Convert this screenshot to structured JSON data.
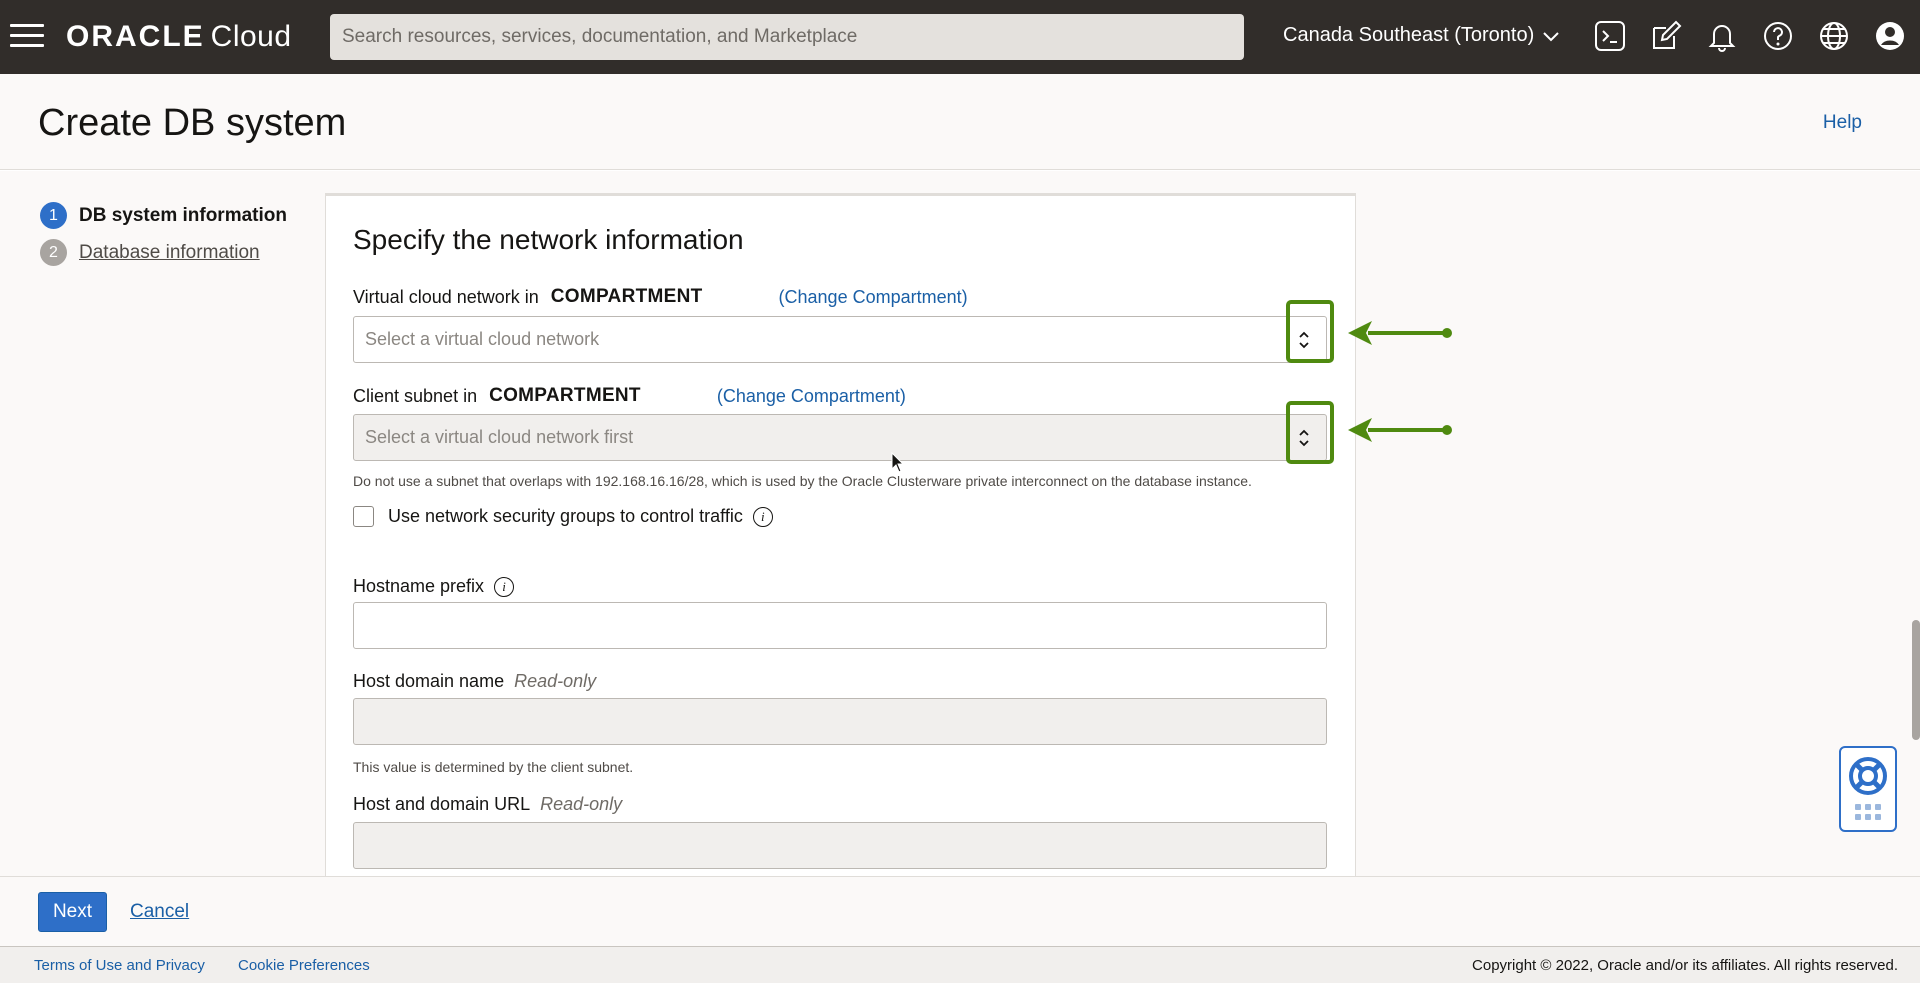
{
  "topbar": {
    "brand_main": "ORACLE",
    "brand_sub": "Cloud",
    "search_placeholder": "Search resources, services, documentation, and Marketplace",
    "region": "Canada Southeast (Toronto)",
    "icons": [
      "cloud-shell-icon",
      "edit-icon",
      "bell-icon",
      "help-icon",
      "globe-icon",
      "profile-icon"
    ]
  },
  "header": {
    "title": "Create DB system",
    "help": "Help"
  },
  "steps": [
    {
      "num": "1",
      "label": "DB system information",
      "state": "active"
    },
    {
      "num": "2",
      "label": "Database information",
      "state": "inactive"
    }
  ],
  "form": {
    "section_title": "Specify the network information",
    "vcn": {
      "label": "Virtual cloud network in",
      "compartment": "COMPARTMENT",
      "change": "(Change Compartment)",
      "placeholder": "Select a virtual cloud network"
    },
    "subnet": {
      "label": "Client subnet in",
      "compartment": "COMPARTMENT",
      "change": "(Change Compartment)",
      "placeholder": "Select a virtual cloud network first",
      "hint": "Do not use a subnet that overlaps with 192.168.16.16/28, which is used by the Oracle Clusterware private interconnect on the database instance."
    },
    "nsg_checkbox": {
      "label": "Use network security groups to control traffic",
      "checked": false
    },
    "hostname_prefix": {
      "label": "Hostname prefix",
      "value": ""
    },
    "host_domain": {
      "label": "Host domain name",
      "readonly_tag": "Read-only",
      "hint": "This value is determined by the client subnet."
    },
    "host_url": {
      "label": "Host and domain URL",
      "readonly_tag": "Read-only"
    }
  },
  "actions": {
    "next": "Next",
    "cancel": "Cancel"
  },
  "footer": {
    "terms": "Terms of Use and Privacy",
    "cookies": "Cookie Preferences",
    "copyright": "Copyright © 2022, Oracle and/or its affiliates. All rights reserved."
  },
  "colors": {
    "topbar_bg": "#312d2a",
    "accent_blue": "#2e6fc8",
    "link_blue": "#1a5fa6",
    "highlight_green": "#4f8a10"
  }
}
